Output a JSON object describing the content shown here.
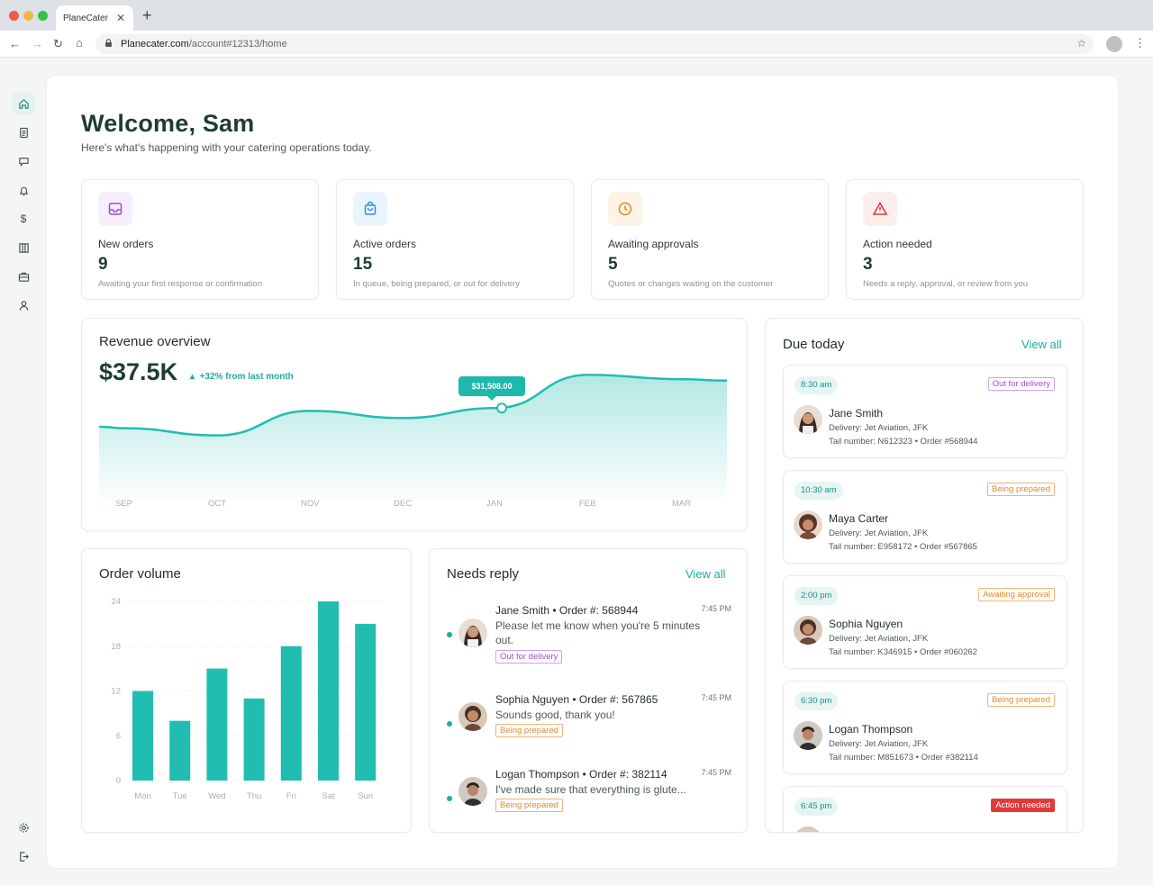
{
  "browser": {
    "tab_title": "PlaneCater",
    "url_host": "Planecater.com",
    "url_path": "/account#12313/home"
  },
  "colors": {
    "brand": "#22aaa0",
    "bars": "#22bdb1",
    "heading": "#1f3b37"
  },
  "header": {
    "title": "Welcome, Sam",
    "subtitle": "Here's what's happening with your catering operations today."
  },
  "stats": [
    {
      "label": "New orders",
      "value": "9",
      "description": "Awaiting your first response or confirmation",
      "icon": "inbox-icon"
    },
    {
      "label": "Active orders",
      "value": "15",
      "description": "In queue, being prepared, or out for delivery",
      "icon": "bag-icon"
    },
    {
      "label": "Awaiting approvals",
      "value": "5",
      "description": "Quotes or changes waiting on the customer",
      "icon": "clock-icon"
    },
    {
      "label": "Action needed",
      "value": "3",
      "description": "Needs a reply, approval, or review from you",
      "icon": "warning-icon"
    }
  ],
  "revenue": {
    "title": "Revenue overview",
    "value": "$37.5K",
    "change": "+32% from last month",
    "tooltip": "$31,508.00"
  },
  "chart_data": [
    {
      "type": "area",
      "title": "Revenue overview",
      "categories": [
        "SEP",
        "OCT",
        "NOV",
        "DEC",
        "JAN",
        "FEB",
        "MAR"
      ],
      "values": [
        0.49,
        0.44,
        0.61,
        0.56,
        0.63,
        0.86,
        0.83
      ],
      "highlight": {
        "category": "JAN",
        "label": "$31,508.00"
      }
    },
    {
      "type": "bar",
      "title": "Order volume",
      "categories": [
        "Mon",
        "Tue",
        "Wed",
        "Thu",
        "Fri",
        "Sat",
        "Sun"
      ],
      "values": [
        12,
        8,
        15,
        11,
        18,
        24,
        21
      ],
      "ylim": [
        0,
        24
      ],
      "yticks": [
        "0",
        "6",
        "12",
        "18",
        "24"
      ]
    }
  ],
  "order_volume": {
    "title": "Order volume"
  },
  "needs_reply": {
    "title": "Needs reply",
    "view_all": "View all",
    "messages": [
      {
        "head": "Jane Smith • Order #: 568944",
        "time": "7:45 PM",
        "text": "Please let me know when you're 5 minutes out.",
        "status": "Out for delivery"
      },
      {
        "head": "Sophia Nguyen • Order #: 567865",
        "time": "7:45 PM",
        "text": "Sounds good, thank you!",
        "status": "Being prepared"
      },
      {
        "head": "Logan Thompson • Order #: 382114",
        "time": "7:45 PM",
        "text": "I've made sure that everything is glute...",
        "status": "Being prepared"
      }
    ]
  },
  "due_today": {
    "title": "Due today",
    "view_all": "View all",
    "items": [
      {
        "time": "8:30 am",
        "status": "Out for delivery",
        "name": "Jane Smith",
        "delivery": "Delivery: Jet Aviation, JFK",
        "tail": "Tail number: N612323  •  Order #568944"
      },
      {
        "time": "10:30 am",
        "status": "Being prepared",
        "name": "Maya Carter",
        "delivery": "Delivery: Jet Aviation, JFK",
        "tail": "Tail number: E958172 • Order #567865"
      },
      {
        "time": "2:00 pm",
        "status": "Awaiting approval",
        "name": "Sophia Nguyen",
        "delivery": "Delivery: Jet Aviation, JFK",
        "tail": "Tail number: K346915 • Order #060262"
      },
      {
        "time": "6:30 pm",
        "status": "Being prepared",
        "name": "Logan Thompson",
        "delivery": "Delivery: Jet Aviation, JFK",
        "tail": "Tail number: M851673 • Order #382114"
      },
      {
        "time": "6:45 pm",
        "status": "Action needed"
      }
    ]
  },
  "sidebar_icons": [
    "home-icon",
    "document-icon",
    "chat-icon",
    "bell-icon",
    "dollar-icon",
    "columns-icon",
    "briefcase-icon",
    "user-icon",
    "settings-icon",
    "logout-icon"
  ]
}
